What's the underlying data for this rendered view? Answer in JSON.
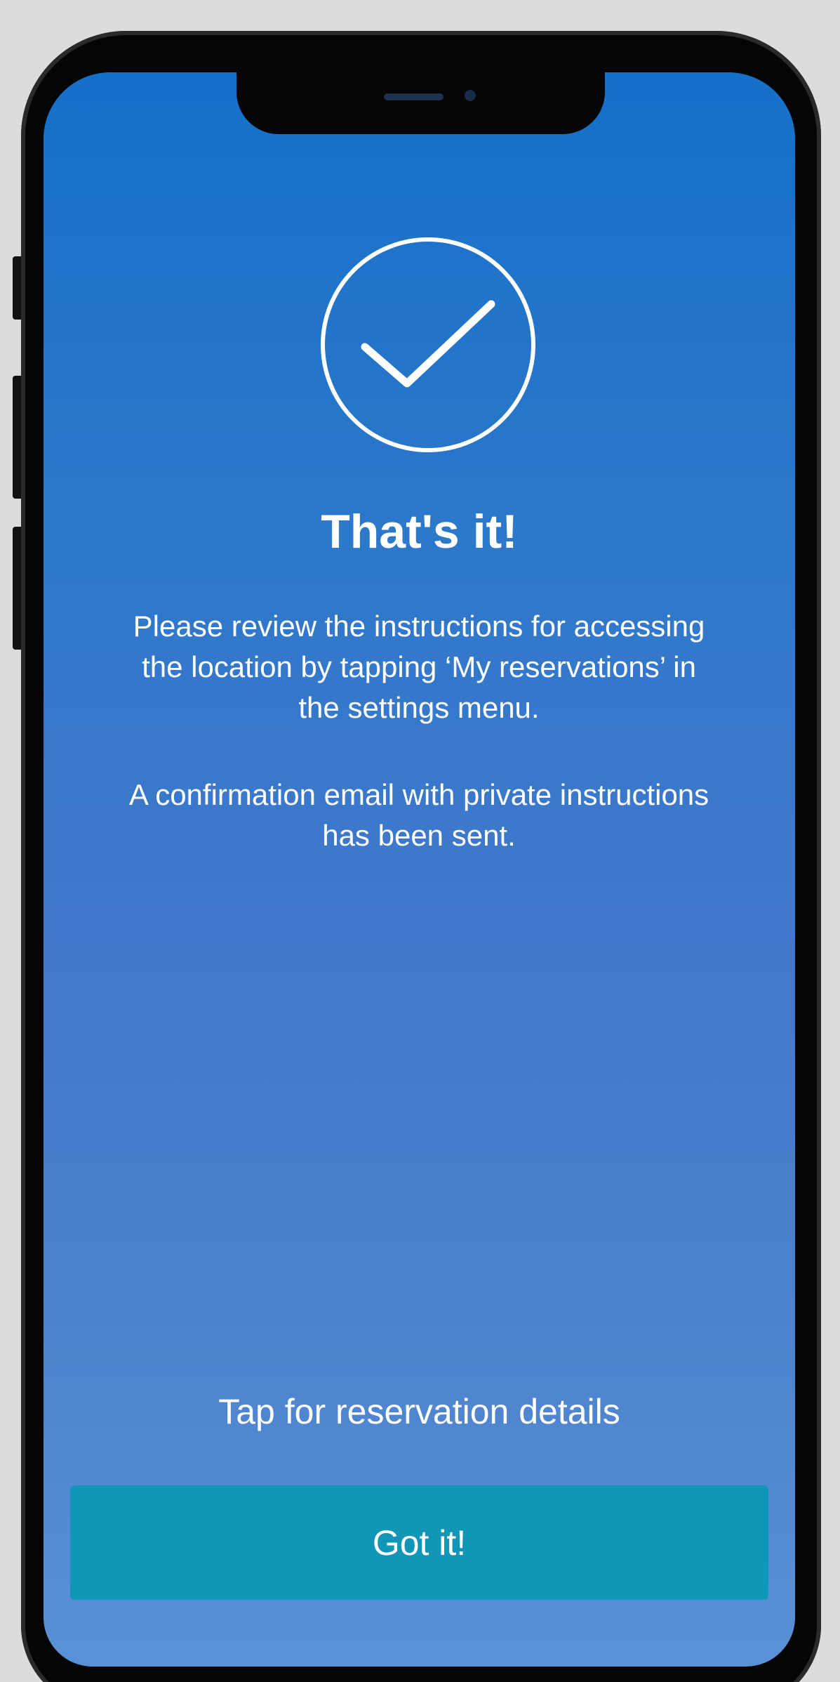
{
  "confirmation": {
    "title": "That's it!",
    "review_instructions": "Please review the instructions for accessing the location by tapping ‘My reservations’ in the settings menu.",
    "email_notice": "A confirmation email with private instructions has been sent."
  },
  "actions": {
    "details_link": "Tap for reservation details",
    "got_it_label": "Got it!"
  },
  "colors": {
    "screen_top": "#1570c9",
    "screen_bottom": "#5a91d6",
    "button": "#1296b8",
    "text": "#ffffff"
  },
  "icons": {
    "status": "checkmark-circle-icon"
  }
}
